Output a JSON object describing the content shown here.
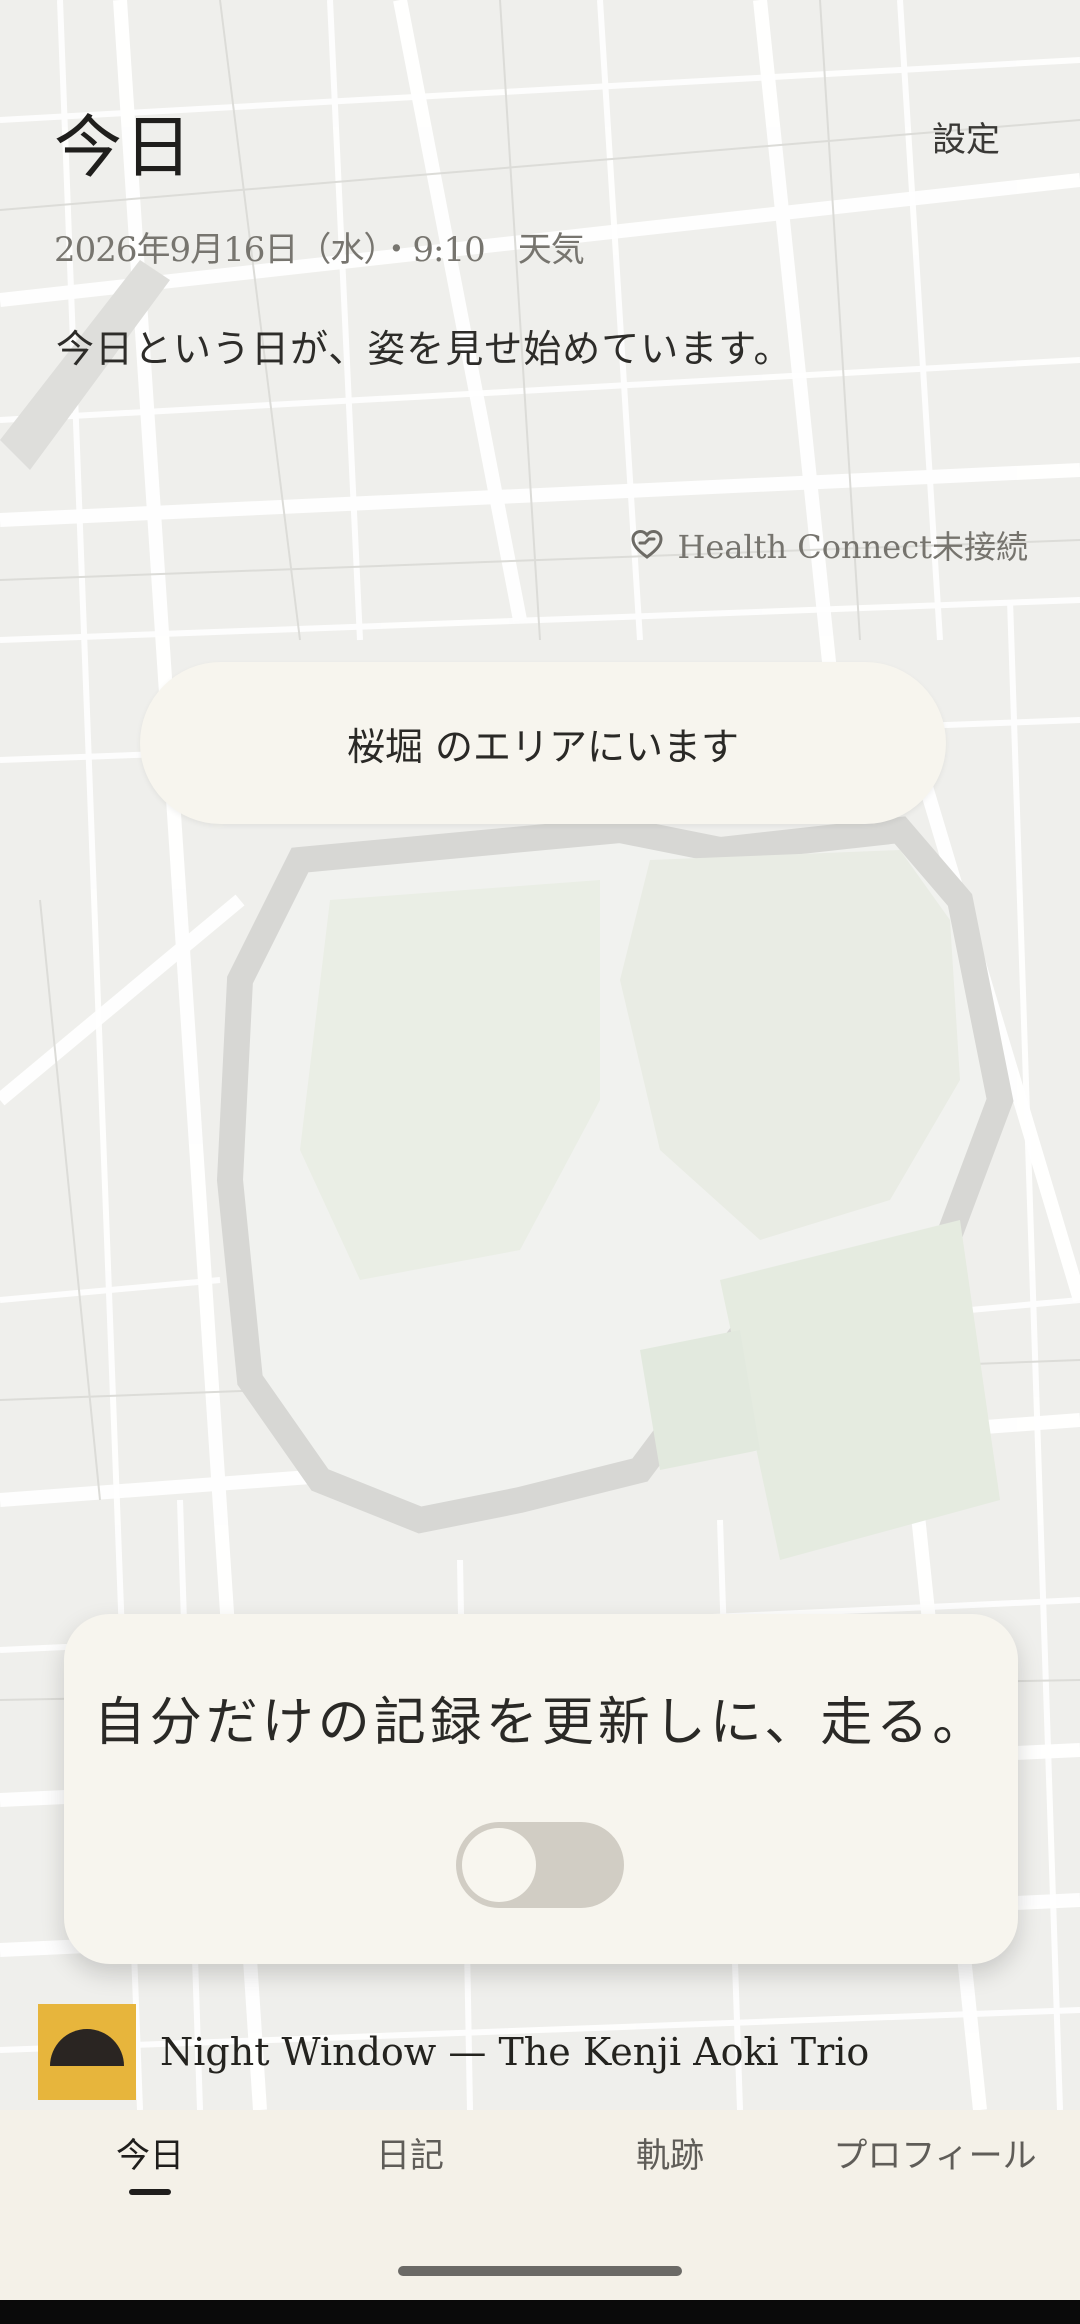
{
  "header": {
    "title": "今日",
    "settings_label": "設定",
    "date_line": "2026年9月16日（水）・9:10　天気",
    "tagline": "今日という日が、姿を見せ始めています。"
  },
  "health": {
    "icon": "heart-link-icon",
    "status": "Health Connect未接続"
  },
  "area": {
    "text": "桜堀 のエリアにいます"
  },
  "run_card": {
    "headline": "自分だけの記録を更新しに、走る。",
    "toggle_on": false
  },
  "now_playing": {
    "track": "Night Window — The Kenji Aoki Trio",
    "art_color": "#e7b53c"
  },
  "nav": {
    "tabs": [
      {
        "label": "今日",
        "active": true
      },
      {
        "label": "日記",
        "active": false
      },
      {
        "label": "軌跡",
        "active": false
      },
      {
        "label": "プロフィール",
        "active": false
      }
    ]
  },
  "colors": {
    "card_bg": "#f7f5ee",
    "nav_bg": "#f4f1e8",
    "map_water": "#d7d7d4",
    "map_park": "#e6ebe1",
    "accent_art": "#e7b53c"
  }
}
